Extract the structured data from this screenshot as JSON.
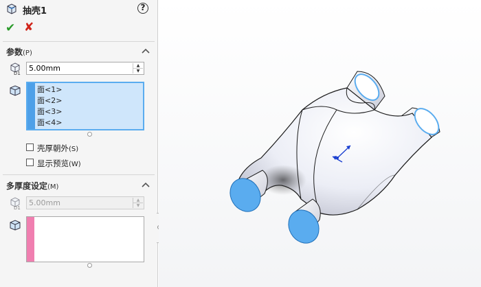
{
  "header": {
    "title": "抽壳1",
    "help_icon": "help-icon"
  },
  "actions": {
    "ok_icon": "✔",
    "cancel_icon": "✘"
  },
  "params": {
    "title": "参数",
    "accel": "(P)",
    "thickness_value": "5.00mm",
    "faces": [
      "面<1>",
      "面<2>",
      "面<3>",
      "面<4>"
    ],
    "faces_color": "#4ea0e8",
    "shell_outward": {
      "label": "壳厚朝外",
      "accel": "(S)",
      "checked": false
    },
    "show_preview": {
      "label": "显示预览",
      "accel": "(W)",
      "checked": false
    }
  },
  "multi": {
    "title": "多厚度设定",
    "accel": "(M)",
    "thickness_value": "5.00mm",
    "faces": [],
    "faces_color": "#f07fb0"
  },
  "colors": {
    "selected_face": "#5aacef",
    "ok": "#2a9a2a",
    "cancel": "#d0241a"
  }
}
